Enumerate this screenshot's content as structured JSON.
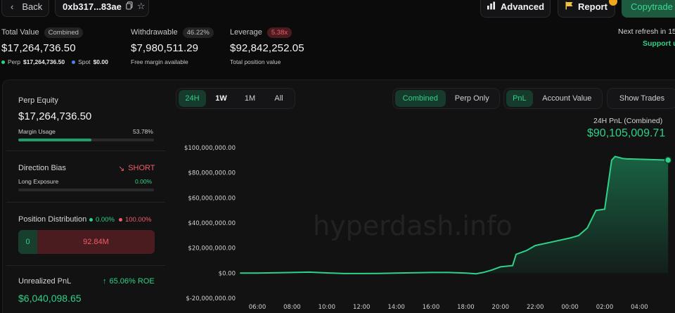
{
  "header": {
    "back_label": "Back",
    "address": "0xb317...83ae",
    "advanced_label": "Advanced",
    "report_label": "Report",
    "copytrade_label": "Copytrade"
  },
  "stats": {
    "total_value": {
      "label": "Total Value",
      "badge": "Combined",
      "value": "$17,264,736.50",
      "perp_label": "Perp",
      "perp_value": "$17,264,736.50",
      "spot_label": "Spot",
      "spot_value": "$0.00"
    },
    "withdrawable": {
      "label": "Withdrawable",
      "badge": "46.22%",
      "value": "$7,980,511.29",
      "sub": "Free margin available"
    },
    "leverage": {
      "label": "Leverage",
      "badge": "5.38x",
      "value": "$92,842,252.05",
      "sub": "Total position value"
    },
    "refresh_text": "Next refresh in 15",
    "support_text": "Support u"
  },
  "sidebar": {
    "perp_equity_label": "Perp Equity",
    "perp_equity_value": "$17,264,736.50",
    "margin_usage_label": "Margin Usage",
    "margin_usage_value": "53.78%",
    "margin_usage_fraction": 0.5378,
    "direction_bias_label": "Direction Bias",
    "direction_bias_value": "SHORT",
    "long_exposure_label": "Long Exposure",
    "long_exposure_value": "0.00%",
    "position_distribution_label": "Position Distribution",
    "long_pct": "0.00%",
    "short_pct": "100.00%",
    "long_amount": "0",
    "short_amount": "92.84M",
    "unrealized_label": "Unrealized PnL",
    "roe": "65.06% ROE",
    "unrealized_value": "$6,040,098.65"
  },
  "controls": {
    "timeframes": [
      "24H",
      "1W",
      "1M",
      "All"
    ],
    "timeframe_active": "24H",
    "scope": [
      "Combined",
      "Perp Only"
    ],
    "scope_active": "Combined",
    "metric": [
      "PnL",
      "Account Value"
    ],
    "metric_active": "PnL",
    "show_trades_label": "Show Trades"
  },
  "pnl_summary": {
    "title": "24H PnL (Combined)",
    "value": "$90,105,009.71"
  },
  "watermark": "hyperdash.info",
  "colors": {
    "accent": "#2fd187",
    "negative": "#f05d68",
    "warning": "#f0a81c"
  },
  "chart_data": {
    "type": "area",
    "title": "24H PnL (Combined)",
    "xlabel": "",
    "ylabel": "",
    "ylim": [
      -20000000,
      100000000
    ],
    "xlim": [
      5.0,
      5.65
    ],
    "yticks": [
      100000000,
      80000000,
      60000000,
      40000000,
      20000000,
      0,
      -20000000
    ],
    "ytick_labels": [
      "$100,000,000.00",
      "$80,000,000.00",
      "$60,000,000.00",
      "$40,000,000.00",
      "$20,000,000.00",
      "$0.00",
      "$-20,000,000.00"
    ],
    "xtick_labels": [
      "06:00",
      "08:00",
      "10:00",
      "12:00",
      "14:00",
      "16:00",
      "18:00",
      "20:00",
      "22:00",
      "00:00",
      "02:00",
      "04:00"
    ],
    "grid": false,
    "series": [
      {
        "x": [
          5.0,
          6.0,
          8.0,
          9.0,
          10.0,
          11.0,
          12.0,
          13.0,
          14.0,
          16.0,
          17.0,
          18.0,
          18.6,
          19.0,
          19.5,
          20.0,
          20.7,
          20.9,
          21.5,
          22.0,
          23.0,
          24.0,
          24.5,
          25.0,
          25.5,
          26.0,
          26.4,
          26.6,
          26.9,
          27.0,
          27.3,
          27.5,
          28.0,
          28.5,
          29.0,
          29.65
        ],
        "y": [
          0,
          0,
          500000,
          800000,
          200000,
          -300000,
          -300000,
          -200000,
          0,
          500000,
          500000,
          0,
          -500000,
          500000,
          2500000,
          5000000,
          6000000,
          15000000,
          18000000,
          22000000,
          25000000,
          28000000,
          30000000,
          36000000,
          50000000,
          51000000,
          90000000,
          93000000,
          92000000,
          91500000,
          91000000,
          91000000,
          90800000,
          90600000,
          90400000,
          90105009.71
        ]
      }
    ]
  }
}
